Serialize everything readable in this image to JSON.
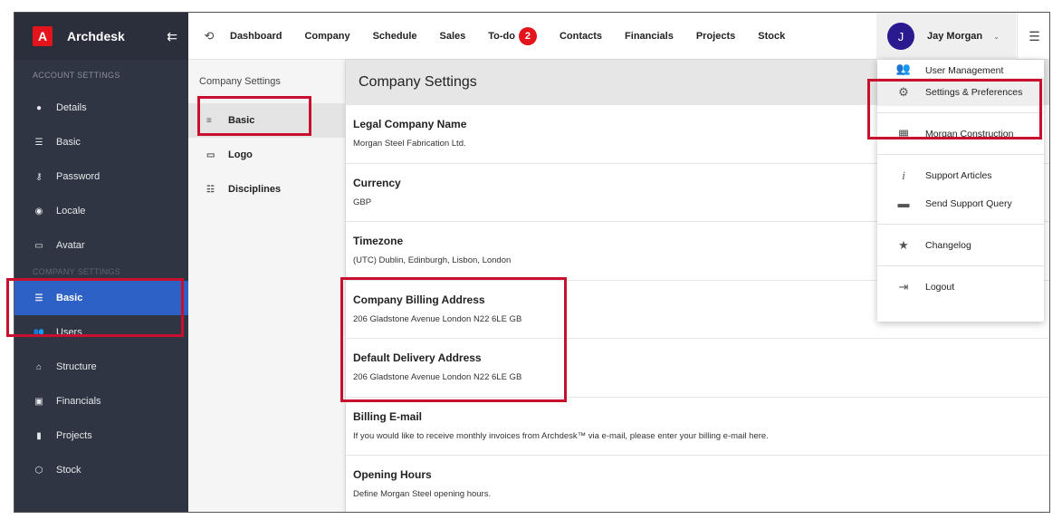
{
  "app": {
    "logo_letter": "A",
    "name": "Archdesk"
  },
  "sidebar": {
    "account_heading": "ACCOUNT SETTINGS",
    "account_items": [
      {
        "label": "Details",
        "icon": "person-icon"
      },
      {
        "label": "Basic",
        "icon": "list-icon"
      },
      {
        "label": "Password",
        "icon": "key-icon"
      },
      {
        "label": "Locale",
        "icon": "compass-icon"
      },
      {
        "label": "Avatar",
        "icon": "monitor-icon"
      }
    ],
    "company_heading": "COMPANY SETTINGS",
    "company_items": [
      {
        "label": "Basic",
        "icon": "list-icon",
        "active": true
      },
      {
        "label": "Users",
        "icon": "users-icon"
      },
      {
        "label": "Structure",
        "icon": "bank-icon"
      },
      {
        "label": "Financials",
        "icon": "money-icon"
      },
      {
        "label": "Projects",
        "icon": "clipboard-icon"
      },
      {
        "label": "Stock",
        "icon": "cube-icon"
      }
    ]
  },
  "topnav": {
    "items": [
      "Dashboard",
      "Company",
      "Schedule",
      "Sales",
      "To-do",
      "Contacts",
      "Financials",
      "Projects",
      "Stock"
    ],
    "todo_count": "2",
    "user_initial": "J",
    "user_name": "Jay Morgan"
  },
  "subnav": {
    "title": "Company Settings",
    "items": [
      "Basic",
      "Logo",
      "Disciplines"
    ]
  },
  "main": {
    "title": "Company Settings",
    "fields": [
      {
        "label": "Legal Company Name",
        "value": "Morgan Steel Fabrication Ltd."
      },
      {
        "label": "Currency",
        "value": "GBP"
      },
      {
        "label": "Timezone",
        "value": "(UTC) Dublin, Edinburgh, Lisbon, London"
      },
      {
        "label": "Company Billing Address",
        "value": "206 Gladstone Avenue London N22 6LE GB"
      },
      {
        "label": "Default Delivery Address",
        "value": "206 Gladstone Avenue London N22 6LE GB"
      },
      {
        "label": "Billing E-mail",
        "value": "If you would like to receive monthly invoices from Archdesk™ via e-mail, please enter your billing e-mail here."
      },
      {
        "label": "Opening Hours",
        "value": "Define Morgan Steel opening hours."
      }
    ]
  },
  "user_menu": {
    "items": [
      "User Management",
      "Settings & Preferences",
      "Morgan Construction",
      "Support Articles",
      "Send Support Query",
      "Changelog",
      "Logout"
    ]
  },
  "colors": {
    "accent": "#2d61c5",
    "brand_red": "#e3141c",
    "highlight_red": "#c8102e",
    "sidebar_bg": "#2f3542"
  }
}
